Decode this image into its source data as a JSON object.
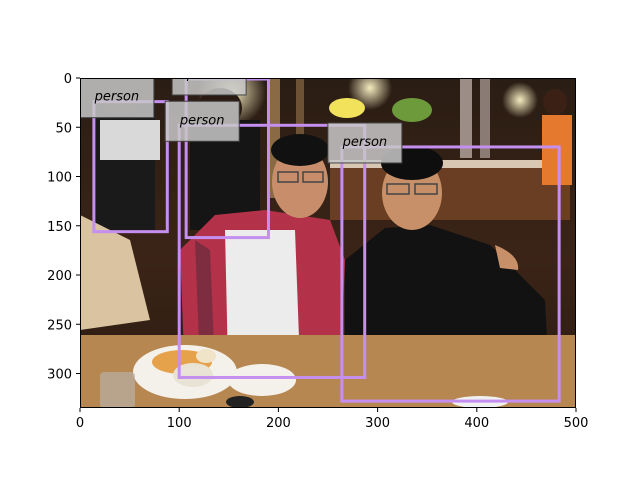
{
  "photo": {
    "description": "Restaurant photo: two men posing at a dinner table; diners and staff in the background."
  },
  "axes": {
    "x_ticks": [
      "0",
      "100",
      "200",
      "300",
      "400",
      "500"
    ],
    "y_ticks": [
      "0",
      "50",
      "100",
      "150",
      "200",
      "250",
      "300"
    ],
    "xlim": [
      0,
      500
    ],
    "ylim": [
      335,
      0
    ]
  },
  "detections": [
    {
      "label": "person",
      "x0": 14,
      "y0": 24,
      "x1": 88,
      "y1": 156,
      "color": "#c58ff0"
    },
    {
      "label": "person",
      "x0": 107,
      "y0": 1,
      "x1": 190,
      "y1": 162,
      "color": "#c58ff0"
    },
    {
      "label": "person",
      "x0": 100,
      "y0": 48,
      "x1": 287,
      "y1": 304,
      "color": "#c58ff0"
    },
    {
      "label": "person",
      "x0": 264,
      "y0": 70,
      "x1": 483,
      "y1": 328,
      "color": "#c58ff0"
    }
  ],
  "colors": {
    "box": "#c58ff0",
    "label_bg": "#c8c8c8",
    "axis": "#000000"
  }
}
